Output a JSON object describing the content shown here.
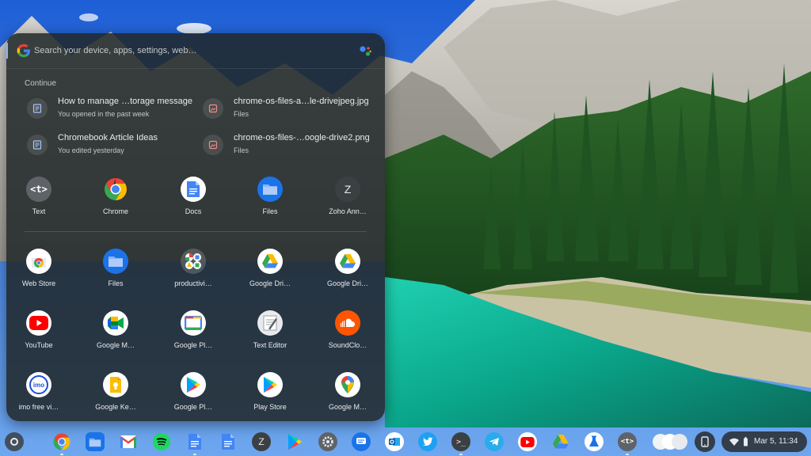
{
  "search": {
    "placeholder": "Search your device, apps, settings, web…"
  },
  "continue": {
    "label": "Continue",
    "items": [
      {
        "title": "How to manage …torage message",
        "subtitle": "You opened in the past week",
        "icon": "document-icon"
      },
      {
        "title": "chrome-os-files-a…le-drivejpeg.jpg",
        "subtitle": "Files",
        "icon": "image-file-icon"
      },
      {
        "title": "Chromebook Article Ideas",
        "subtitle": "You edited yesterday",
        "icon": "document-icon"
      },
      {
        "title": "chrome-os-files-…oogle-drive2.png",
        "subtitle": "Files",
        "icon": "image-file-icon"
      }
    ]
  },
  "suggested_apps": [
    {
      "label": "Text",
      "icon": "text-app-icon"
    },
    {
      "label": "Chrome",
      "icon": "chrome-icon"
    },
    {
      "label": "Docs",
      "icon": "docs-icon"
    },
    {
      "label": "Files",
      "icon": "files-icon"
    },
    {
      "label": "Zoho Ann…",
      "icon": "zoho-icon",
      "letter": "Z"
    }
  ],
  "apps": [
    {
      "label": "Web Store",
      "icon": "web-store-icon"
    },
    {
      "label": "Files",
      "icon": "files-icon"
    },
    {
      "label": "productivi…",
      "icon": "productivity-folder-icon"
    },
    {
      "label": "Google Dri…",
      "icon": "google-drive-icon"
    },
    {
      "label": "Google Dri…",
      "icon": "google-drive-icon"
    },
    {
      "label": "YouTube",
      "icon": "youtube-icon"
    },
    {
      "label": "Google M…",
      "icon": "google-meet-icon"
    },
    {
      "label": "Google Pl…",
      "icon": "google-play-books-icon"
    },
    {
      "label": "Text Editor",
      "icon": "text-editor-icon"
    },
    {
      "label": "SoundClo…",
      "icon": "soundcloud-icon"
    },
    {
      "label": "imo free vi…",
      "icon": "imo-icon",
      "text": "imo"
    },
    {
      "label": "Google Ke…",
      "icon": "google-keep-icon"
    },
    {
      "label": "Google Pl…",
      "icon": "google-play-icon"
    },
    {
      "label": "Play Store",
      "icon": "play-store-icon"
    },
    {
      "label": "Google M…",
      "icon": "google-maps-icon"
    }
  ],
  "shelf": {
    "apps": [
      {
        "name": "chrome-icon",
        "running": true
      },
      {
        "name": "files-icon",
        "running": false
      },
      {
        "name": "gmail-icon",
        "running": false
      },
      {
        "name": "spotify-icon",
        "running": false
      },
      {
        "name": "docs-icon",
        "running": true
      },
      {
        "name": "docs-icon",
        "running": false
      },
      {
        "name": "zoho-icon",
        "running": false,
        "letter": "Z"
      },
      {
        "name": "play-store-icon",
        "running": false
      },
      {
        "name": "settings-icon",
        "running": false
      },
      {
        "name": "messages-icon",
        "running": false
      },
      {
        "name": "outlook-icon",
        "running": false
      },
      {
        "name": "twitter-icon",
        "running": false
      },
      {
        "name": "terminal-icon",
        "running": true
      },
      {
        "name": "telegram-icon",
        "running": false
      },
      {
        "name": "youtube-icon",
        "running": false
      },
      {
        "name": "google-drive-icon",
        "running": false
      },
      {
        "name": "labs-flask-icon",
        "running": false
      },
      {
        "name": "text-app-icon",
        "running": true
      }
    ],
    "clock": "Mar 5, 11:34"
  },
  "colors": {
    "google_blue": "#4285f4",
    "google_red": "#ea4335",
    "google_yellow": "#fbbc04",
    "google_green": "#34a853",
    "launcher_bg": "#202628"
  }
}
